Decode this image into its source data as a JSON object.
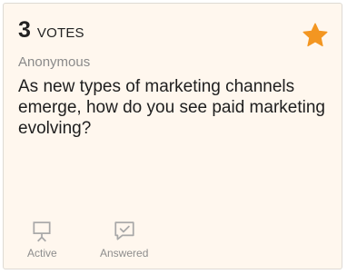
{
  "card": {
    "votes_count": "3",
    "votes_label": "VOTES",
    "author": "Anonymous",
    "question": "As new types of marketing channels emerge, how do you see paid marketing evolving?",
    "starred": true,
    "star_color": "#f39621",
    "background_color": "#fff7ee",
    "actions": [
      {
        "label": "Active",
        "icon": "presentation-board-icon"
      },
      {
        "label": "Answered",
        "icon": "checked-message-icon"
      }
    ]
  }
}
